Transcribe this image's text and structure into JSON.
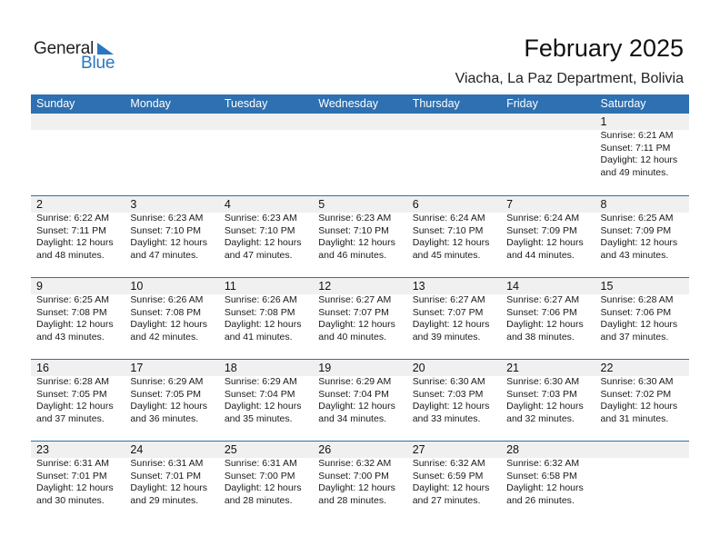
{
  "logo": {
    "general": "General",
    "blue": "Blue",
    "icon": "triangle-flag-icon"
  },
  "header": {
    "title": "February 2025",
    "subtitle": "Viacha, La Paz Department, Bolivia"
  },
  "colors": {
    "accent": "#2e70b1",
    "band": "#f0f0f0",
    "logo_blue": "#2a77c0"
  },
  "weekdays": [
    "Sunday",
    "Monday",
    "Tuesday",
    "Wednesday",
    "Thursday",
    "Friday",
    "Saturday"
  ],
  "weeks": [
    [
      null,
      null,
      null,
      null,
      null,
      null,
      {
        "day": "1",
        "sunrise": "Sunrise: 6:21 AM",
        "sunset": "Sunset: 7:11 PM",
        "daylight1": "Daylight: 12 hours",
        "daylight2": "and 49 minutes."
      }
    ],
    [
      {
        "day": "2",
        "sunrise": "Sunrise: 6:22 AM",
        "sunset": "Sunset: 7:11 PM",
        "daylight1": "Daylight: 12 hours",
        "daylight2": "and 48 minutes."
      },
      {
        "day": "3",
        "sunrise": "Sunrise: 6:23 AM",
        "sunset": "Sunset: 7:10 PM",
        "daylight1": "Daylight: 12 hours",
        "daylight2": "and 47 minutes."
      },
      {
        "day": "4",
        "sunrise": "Sunrise: 6:23 AM",
        "sunset": "Sunset: 7:10 PM",
        "daylight1": "Daylight: 12 hours",
        "daylight2": "and 47 minutes."
      },
      {
        "day": "5",
        "sunrise": "Sunrise: 6:23 AM",
        "sunset": "Sunset: 7:10 PM",
        "daylight1": "Daylight: 12 hours",
        "daylight2": "and 46 minutes."
      },
      {
        "day": "6",
        "sunrise": "Sunrise: 6:24 AM",
        "sunset": "Sunset: 7:10 PM",
        "daylight1": "Daylight: 12 hours",
        "daylight2": "and 45 minutes."
      },
      {
        "day": "7",
        "sunrise": "Sunrise: 6:24 AM",
        "sunset": "Sunset: 7:09 PM",
        "daylight1": "Daylight: 12 hours",
        "daylight2": "and 44 minutes."
      },
      {
        "day": "8",
        "sunrise": "Sunrise: 6:25 AM",
        "sunset": "Sunset: 7:09 PM",
        "daylight1": "Daylight: 12 hours",
        "daylight2": "and 43 minutes."
      }
    ],
    [
      {
        "day": "9",
        "sunrise": "Sunrise: 6:25 AM",
        "sunset": "Sunset: 7:08 PM",
        "daylight1": "Daylight: 12 hours",
        "daylight2": "and 43 minutes."
      },
      {
        "day": "10",
        "sunrise": "Sunrise: 6:26 AM",
        "sunset": "Sunset: 7:08 PM",
        "daylight1": "Daylight: 12 hours",
        "daylight2": "and 42 minutes."
      },
      {
        "day": "11",
        "sunrise": "Sunrise: 6:26 AM",
        "sunset": "Sunset: 7:08 PM",
        "daylight1": "Daylight: 12 hours",
        "daylight2": "and 41 minutes."
      },
      {
        "day": "12",
        "sunrise": "Sunrise: 6:27 AM",
        "sunset": "Sunset: 7:07 PM",
        "daylight1": "Daylight: 12 hours",
        "daylight2": "and 40 minutes."
      },
      {
        "day": "13",
        "sunrise": "Sunrise: 6:27 AM",
        "sunset": "Sunset: 7:07 PM",
        "daylight1": "Daylight: 12 hours",
        "daylight2": "and 39 minutes."
      },
      {
        "day": "14",
        "sunrise": "Sunrise: 6:27 AM",
        "sunset": "Sunset: 7:06 PM",
        "daylight1": "Daylight: 12 hours",
        "daylight2": "and 38 minutes."
      },
      {
        "day": "15",
        "sunrise": "Sunrise: 6:28 AM",
        "sunset": "Sunset: 7:06 PM",
        "daylight1": "Daylight: 12 hours",
        "daylight2": "and 37 minutes."
      }
    ],
    [
      {
        "day": "16",
        "sunrise": "Sunrise: 6:28 AM",
        "sunset": "Sunset: 7:05 PM",
        "daylight1": "Daylight: 12 hours",
        "daylight2": "and 37 minutes."
      },
      {
        "day": "17",
        "sunrise": "Sunrise: 6:29 AM",
        "sunset": "Sunset: 7:05 PM",
        "daylight1": "Daylight: 12 hours",
        "daylight2": "and 36 minutes."
      },
      {
        "day": "18",
        "sunrise": "Sunrise: 6:29 AM",
        "sunset": "Sunset: 7:04 PM",
        "daylight1": "Daylight: 12 hours",
        "daylight2": "and 35 minutes."
      },
      {
        "day": "19",
        "sunrise": "Sunrise: 6:29 AM",
        "sunset": "Sunset: 7:04 PM",
        "daylight1": "Daylight: 12 hours",
        "daylight2": "and 34 minutes."
      },
      {
        "day": "20",
        "sunrise": "Sunrise: 6:30 AM",
        "sunset": "Sunset: 7:03 PM",
        "daylight1": "Daylight: 12 hours",
        "daylight2": "and 33 minutes."
      },
      {
        "day": "21",
        "sunrise": "Sunrise: 6:30 AM",
        "sunset": "Sunset: 7:03 PM",
        "daylight1": "Daylight: 12 hours",
        "daylight2": "and 32 minutes."
      },
      {
        "day": "22",
        "sunrise": "Sunrise: 6:30 AM",
        "sunset": "Sunset: 7:02 PM",
        "daylight1": "Daylight: 12 hours",
        "daylight2": "and 31 minutes."
      }
    ],
    [
      {
        "day": "23",
        "sunrise": "Sunrise: 6:31 AM",
        "sunset": "Sunset: 7:01 PM",
        "daylight1": "Daylight: 12 hours",
        "daylight2": "and 30 minutes."
      },
      {
        "day": "24",
        "sunrise": "Sunrise: 6:31 AM",
        "sunset": "Sunset: 7:01 PM",
        "daylight1": "Daylight: 12 hours",
        "daylight2": "and 29 minutes."
      },
      {
        "day": "25",
        "sunrise": "Sunrise: 6:31 AM",
        "sunset": "Sunset: 7:00 PM",
        "daylight1": "Daylight: 12 hours",
        "daylight2": "and 28 minutes."
      },
      {
        "day": "26",
        "sunrise": "Sunrise: 6:32 AM",
        "sunset": "Sunset: 7:00 PM",
        "daylight1": "Daylight: 12 hours",
        "daylight2": "and 28 minutes."
      },
      {
        "day": "27",
        "sunrise": "Sunrise: 6:32 AM",
        "sunset": "Sunset: 6:59 PM",
        "daylight1": "Daylight: 12 hours",
        "daylight2": "and 27 minutes."
      },
      {
        "day": "28",
        "sunrise": "Sunrise: 6:32 AM",
        "sunset": "Sunset: 6:58 PM",
        "daylight1": "Daylight: 12 hours",
        "daylight2": "and 26 minutes."
      },
      null
    ]
  ]
}
